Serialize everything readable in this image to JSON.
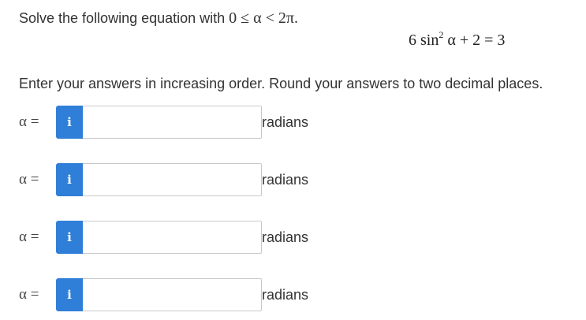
{
  "question": {
    "prompt_text": "Solve the following equation with ",
    "prompt_condition": "0 ≤ α < 2π.",
    "equation_coef": "6 sin",
    "equation_exponent": "2",
    "equation_rest": " α + 2 = 3",
    "instructions": "Enter your answers in increasing order. Round your answers to two decimal places."
  },
  "answers": [
    {
      "label": "α =",
      "info_icon": "i",
      "value": "",
      "unit": "radians"
    },
    {
      "label": "α =",
      "info_icon": "i",
      "value": "",
      "unit": "radians"
    },
    {
      "label": "α =",
      "info_icon": "i",
      "value": "",
      "unit": "radians"
    },
    {
      "label": "α =",
      "info_icon": "i",
      "value": "",
      "unit": "radians"
    }
  ],
  "colors": {
    "info_button": "#2f7fd8",
    "input_border": "#c9c9c9",
    "text": "#333333"
  }
}
